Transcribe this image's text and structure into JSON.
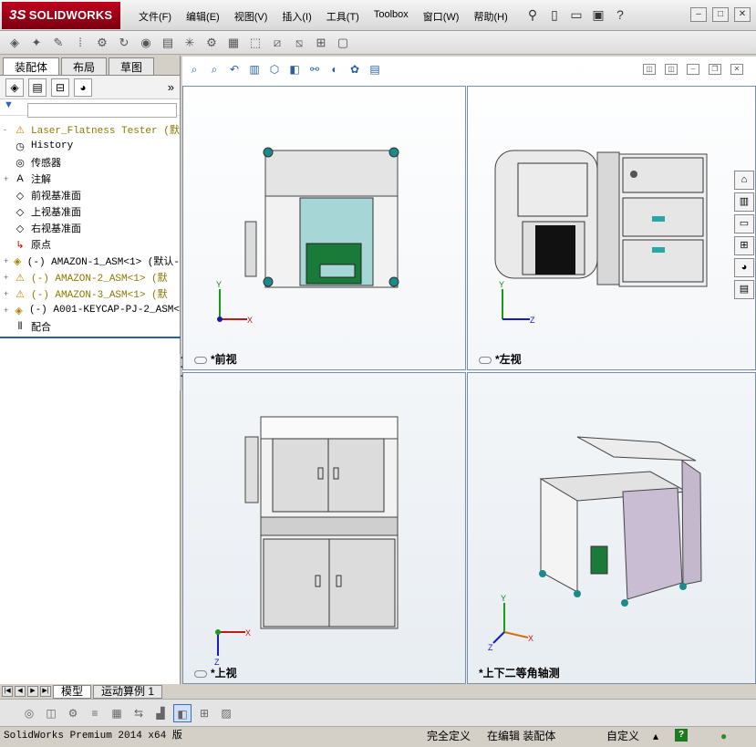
{
  "app": {
    "logo": "SOLIDWORKS",
    "logo_prefix": "3S"
  },
  "menu": [
    "文件(F)",
    "编辑(E)",
    "视图(V)",
    "插入(I)",
    "工具(T)",
    "Toolbox",
    "窗口(W)",
    "帮助(H)"
  ],
  "left_panel": {
    "tabs": [
      "装配体",
      "布局",
      "草图"
    ],
    "tree": [
      {
        "label": "Laser_Flatness Tester  (默",
        "icon": "assembly-warning-icon",
        "expander": "-"
      },
      {
        "label": "History",
        "icon": "history-icon",
        "expander": ""
      },
      {
        "label": "传感器",
        "icon": "sensor-icon",
        "expander": ""
      },
      {
        "label": "注解",
        "icon": "annotation-icon",
        "expander": "+"
      },
      {
        "label": "前视基准面",
        "icon": "plane-icon",
        "expander": ""
      },
      {
        "label": "上视基准面",
        "icon": "plane-icon",
        "expander": ""
      },
      {
        "label": "右视基准面",
        "icon": "plane-icon",
        "expander": ""
      },
      {
        "label": "原点",
        "icon": "origin-icon",
        "expander": ""
      },
      {
        "label": "(-) AMAZON-1_ASM<1> (默认-",
        "icon": "subassembly-icon",
        "expander": "+"
      },
      {
        "label": "(-) AMAZON-2_ASM<1> (默",
        "icon": "subassembly-warning-icon",
        "expander": "+"
      },
      {
        "label": "(-) AMAZON-3_ASM<1> (默",
        "icon": "subassembly-warning-icon",
        "expander": "+"
      },
      {
        "label": "(-) A001-KEYCAP-PJ-2_ASM<",
        "icon": "subassembly-icon",
        "expander": "+"
      },
      {
        "label": "配合",
        "icon": "mates-icon",
        "expander": ""
      }
    ]
  },
  "viewports": [
    {
      "label": "*前视"
    },
    {
      "label": "*左视"
    },
    {
      "label": "*上视"
    },
    {
      "label": "*上下二等角轴测"
    }
  ],
  "bottom_tabs": [
    "模型",
    "运动算例 1"
  ],
  "status": {
    "app_version": "SolidWorks Premium 2014 x64 版",
    "definition": "完全定义",
    "editing": "在编辑 装配体",
    "units": "自定义",
    "help": "?"
  },
  "colors": {
    "brand": "#a00018",
    "viewport_border": "#7a8ea8",
    "accent_blue": "#2a5db0"
  }
}
